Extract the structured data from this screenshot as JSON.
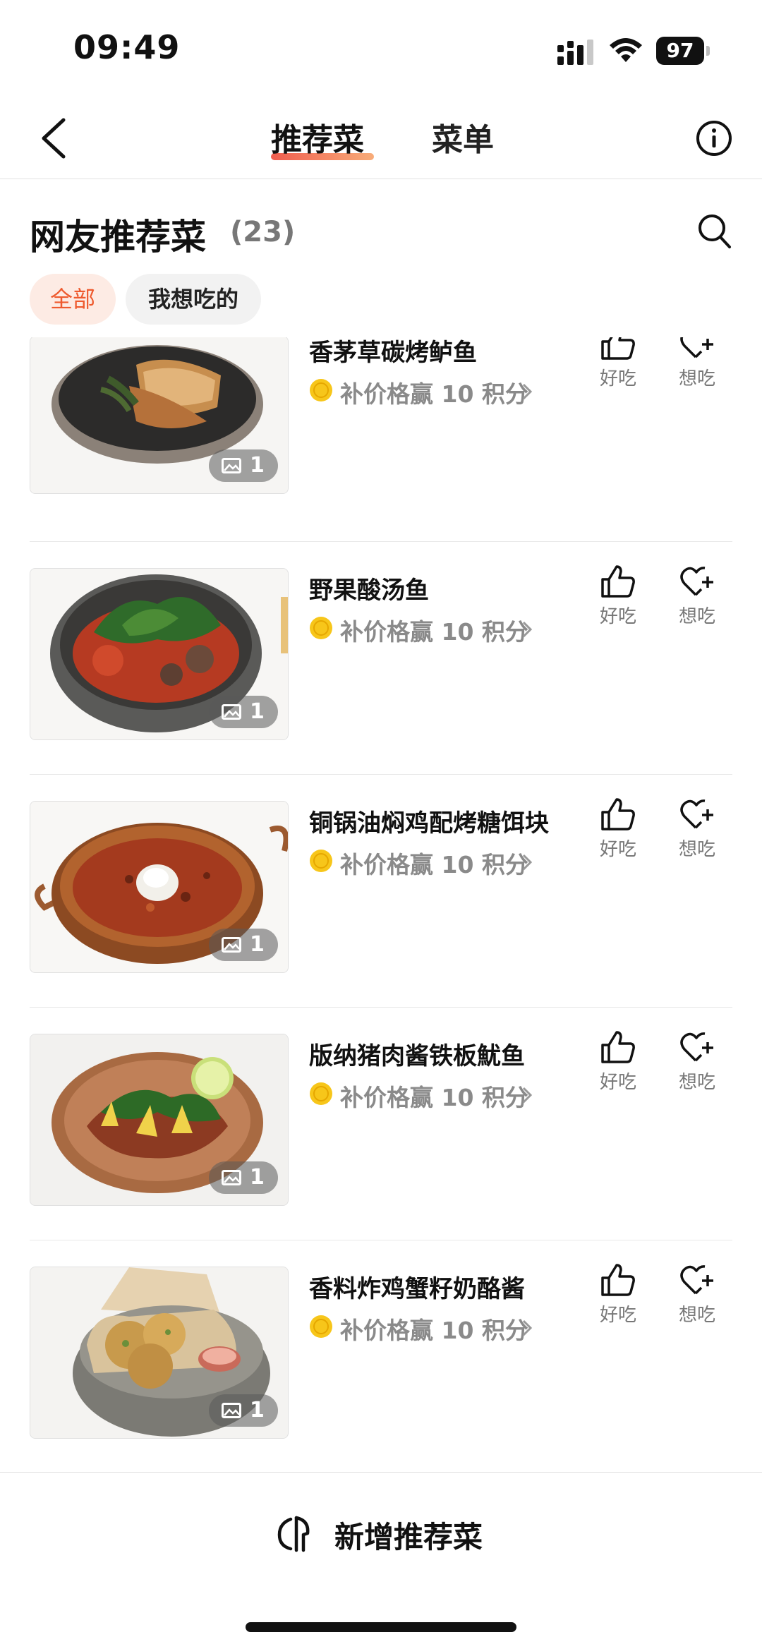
{
  "status_bar": {
    "time": "09:49",
    "battery": "97"
  },
  "nav": {
    "tabs": [
      "推荐菜",
      "菜单"
    ],
    "active_tab": 0
  },
  "section": {
    "title": "网友推荐菜",
    "count": "(23)"
  },
  "filters": [
    "全部",
    "我想吃的"
  ],
  "dishes": [
    {
      "name": "香茅草碳烤鲈鱼",
      "reward": "补价格赢 10 积分",
      "photo_count": "1",
      "good_label": "好吃",
      "want_label": "想吃",
      "icon": "grilled-fish-photo"
    },
    {
      "name": "野果酸汤鱼",
      "reward": "补价格赢 10 积分",
      "photo_count": "1",
      "good_label": "好吃",
      "want_label": "想吃",
      "icon": "sour-soup-fish-photo"
    },
    {
      "name": "铜锅油焖鸡配烤糖饵块",
      "reward": "补价格赢 10 积分",
      "photo_count": "1",
      "good_label": "好吃",
      "want_label": "想吃",
      "icon": "copper-pot-chicken-photo"
    },
    {
      "name": "版纳猪肉酱铁板魷鱼",
      "reward": "补价格赢 10 积分",
      "photo_count": "1",
      "good_label": "好吃",
      "want_label": "想吃",
      "icon": "squid-plate-photo"
    },
    {
      "name": "香料炸鸡蟹籽奶酪酱",
      "reward": "补价格赢 10 积分",
      "photo_count": "1",
      "good_label": "好吃",
      "want_label": "想吃",
      "icon": "fried-chicken-photo"
    }
  ],
  "bottom": {
    "add_label": "新增推荐菜"
  },
  "colors": {
    "accent": "#ee5a2e",
    "chip_active_bg": "#fdebe4",
    "coin": "#f7c61a"
  }
}
